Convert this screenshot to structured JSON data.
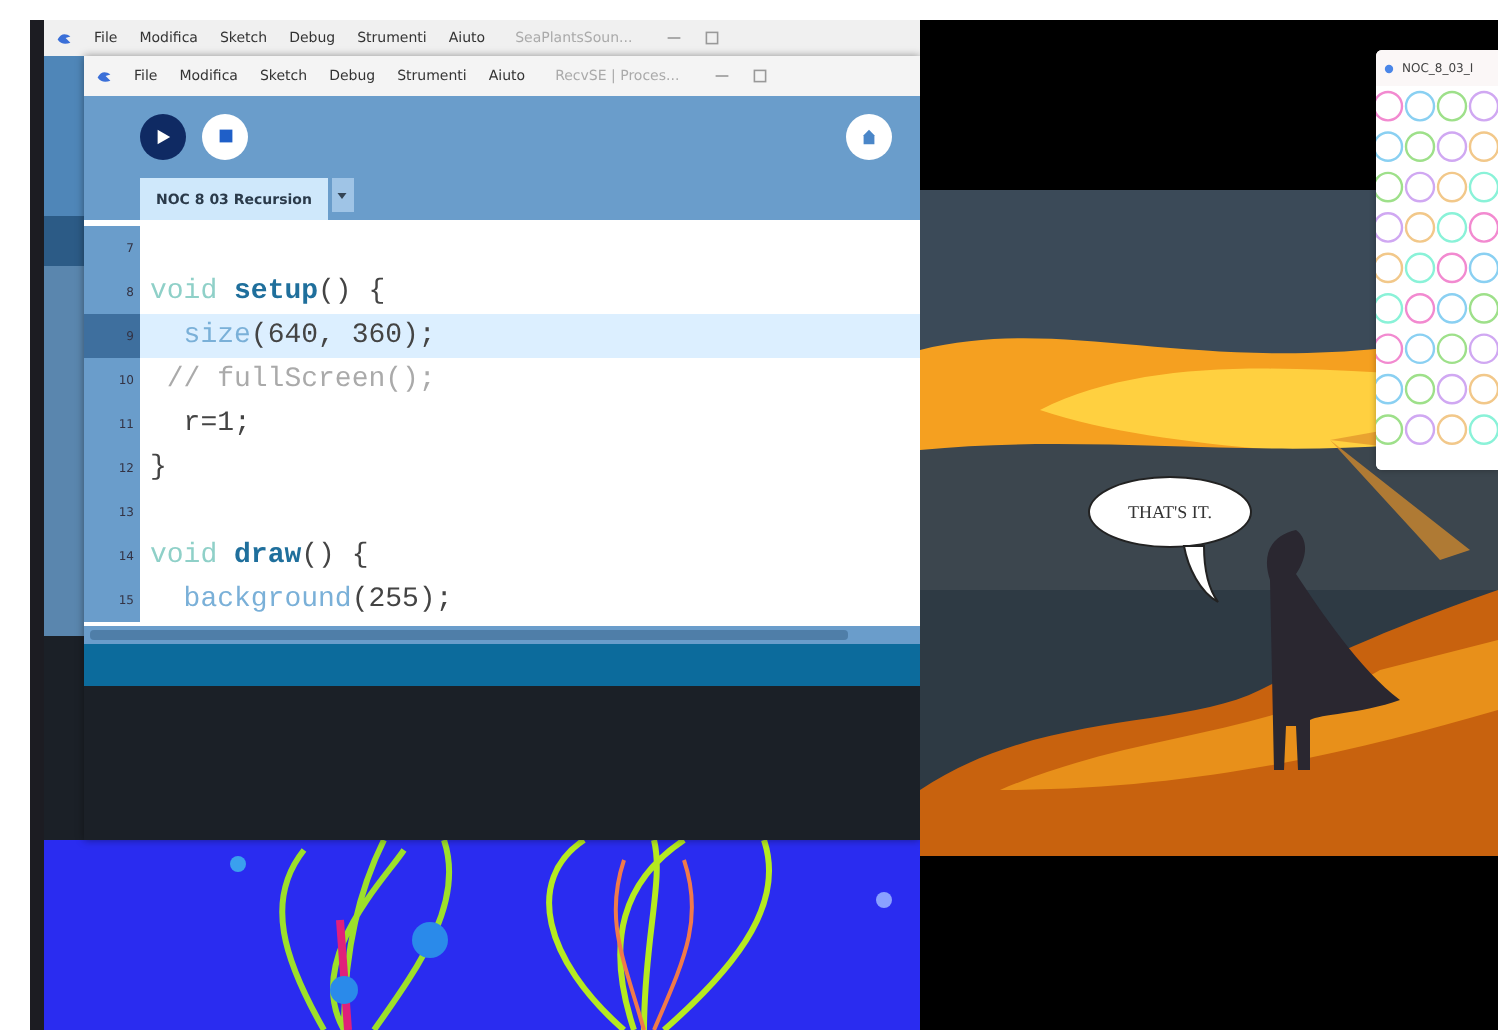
{
  "back_window": {
    "menu": [
      "File",
      "Modifica",
      "Sketch",
      "Debug",
      "Strumenti",
      "Aiuto"
    ],
    "title": "SeaPlantsSoun..."
  },
  "editor_window": {
    "menu": [
      "File",
      "Modifica",
      "Sketch",
      "Debug",
      "Strumenti",
      "Aiuto"
    ],
    "title": "RecvSE | Proces...",
    "tabs": [
      {
        "label": "NOC 8 03 Recursion",
        "selected": true
      }
    ],
    "lines": [
      {
        "number": "7",
        "current": false
      },
      {
        "number": "8",
        "current": false,
        "tokens": [
          {
            "kind": "keyword",
            "text": "void "
          },
          {
            "kind": "function",
            "text": "setup"
          },
          {
            "kind": "plain",
            "text": "() {"
          }
        ]
      },
      {
        "number": "9",
        "current": true,
        "tokens": [
          {
            "kind": "builtin",
            "text": "  size"
          },
          {
            "kind": "plain",
            "text": "(640, 360);"
          }
        ]
      },
      {
        "number": "10",
        "current": false,
        "tokens": [
          {
            "kind": "comment",
            "text": " // fullScreen();"
          }
        ]
      },
      {
        "number": "11",
        "current": false,
        "tokens": [
          {
            "kind": "plain",
            "text": "  r=1;"
          }
        ]
      },
      {
        "number": "12",
        "current": false,
        "tokens": [
          {
            "kind": "plain",
            "text": "}"
          }
        ]
      },
      {
        "number": "13",
        "current": false
      },
      {
        "number": "14",
        "current": false,
        "tokens": [
          {
            "kind": "keyword",
            "text": "void "
          },
          {
            "kind": "function",
            "text": "draw"
          },
          {
            "kind": "plain",
            "text": "() {"
          }
        ]
      },
      {
        "number": "15",
        "current": false,
        "tokens": [
          {
            "kind": "builtin",
            "text": "  background"
          },
          {
            "kind": "plain",
            "text": "(255);"
          }
        ]
      }
    ]
  },
  "sketch_window": {
    "speech_bubble": "THAT'S IT."
  },
  "noc_window": {
    "title": "NOC_8_03_I"
  }
}
